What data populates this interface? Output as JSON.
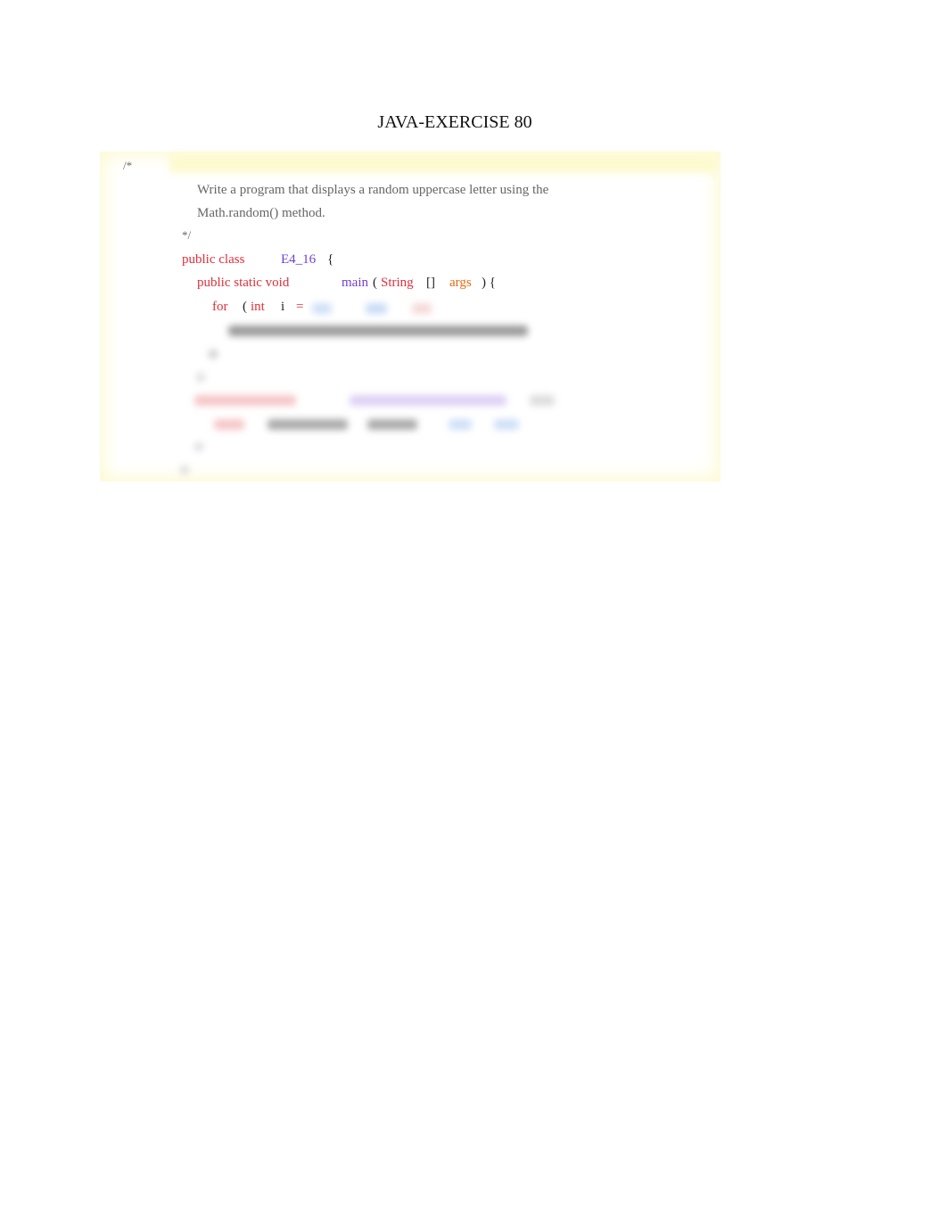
{
  "title": "JAVA-EXERCISE 80",
  "code": {
    "comment_open": "/*",
    "desc1": "Write a program that displays a random uppercase letter using the",
    "desc2": "Math.random() method.",
    "comment_close": "*/",
    "l1": {
      "kw": "public class",
      "name": "E4_16",
      "brace": "{"
    },
    "l2": {
      "kw": "public static void",
      "name": "main",
      "paren": "(",
      "type": "String",
      "arr": "[]",
      "arg": "args",
      "end": ") {"
    },
    "l3": {
      "kw": "for",
      "paren": "(",
      "type": "int",
      "var": "i",
      "eq": "="
    }
  },
  "colors": {
    "keyword": "#e0303a",
    "identifier": "#7040d0",
    "param": "#e06a10",
    "comment": "#666666",
    "highlight": "#fdfad0"
  }
}
